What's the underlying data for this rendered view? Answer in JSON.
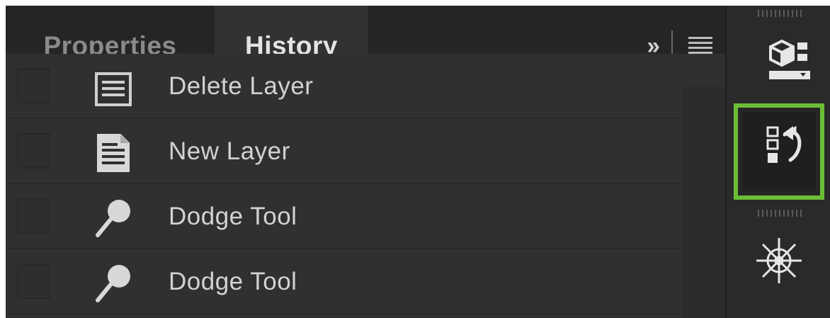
{
  "tabs": [
    {
      "label": "Properties",
      "active": false
    },
    {
      "label": "History",
      "active": true
    }
  ],
  "tab_controls": {
    "expand_icon": "double-chevron-right-icon",
    "expand_label": "››",
    "menu_icon": "panel-menu-icon"
  },
  "history": {
    "items": [
      {
        "label": "Delete Layer",
        "icon": "layer-document-icon"
      },
      {
        "label": "New Layer",
        "icon": "layer-document-icon"
      },
      {
        "label": "Dodge Tool",
        "icon": "dodge-tool-icon"
      },
      {
        "label": "Dodge Tool",
        "icon": "dodge-tool-icon"
      }
    ]
  },
  "dock": {
    "buttons": [
      {
        "name": "3d-properties-icon",
        "active": false
      },
      {
        "name": "history-panel-icon",
        "active": true
      },
      {
        "name": "compass-navigator-icon",
        "active": false
      }
    ]
  },
  "colors": {
    "panel_bg": "#303030",
    "tabbar_bg": "#252525",
    "active_tab_bg": "#323232",
    "text_primary": "#d2d2d2",
    "text_muted": "#8a8a8a",
    "highlight": "#6cbd36"
  }
}
